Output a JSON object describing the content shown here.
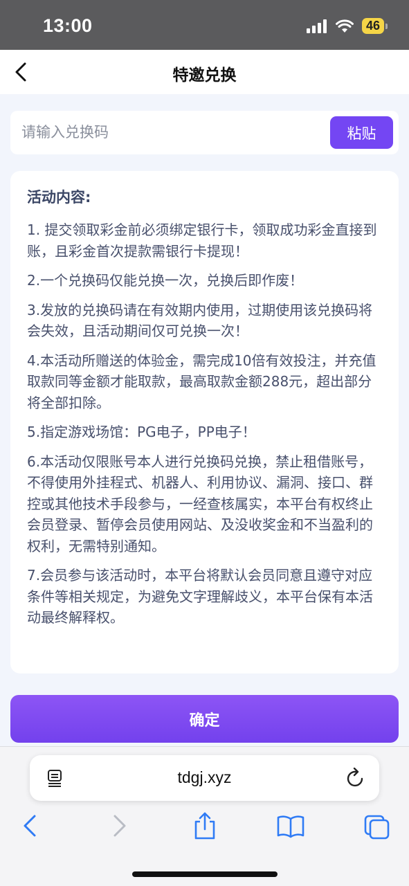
{
  "status": {
    "time": "13:00",
    "battery": "46"
  },
  "nav": {
    "title": "特邀兑换"
  },
  "redeem": {
    "placeholder": "请输入兑换码",
    "value": "",
    "paste_label": "粘贴"
  },
  "content": {
    "heading": "活动内容:",
    "rules": [
      "1. 提交领取彩金前必须绑定银行卡，领取成功彩金直接到账，且彩金首次提款需银行卡提现！",
      "2.一个兑换码仅能兑换一次，兑换后即作废！",
      "3.发放的兑换码请在有效期内使用，过期使用该兑换码将会失效，且活动期间仅可兑换一次！",
      "4.本活动所赠送的体验金，需完成10倍有效投注，并充值取款同等金额才能取款，最高取款金额288元，超出部分将全部扣除。",
      "5.指定游戏场馆：PG电子，PP电子！",
      "6.本活动仅限账号本人进行兑换码兑换，禁止租借账号，不得使用外挂程式、机器人、利用协议、漏洞、接口、群控或其他技术手段参与，一经查核属实，本平台有权终止会员登录、暂停会员使用网站、及没收奖金和不当盈利的权利，无需特别通知。",
      "7.会员参与该活动时，本平台将默认会员同意且遵守对应条件等相关规定，为避免文字理解歧义，本平台保有本活动最终解释权。"
    ]
  },
  "confirm_label": "确定",
  "browser": {
    "url": "tdgj.xyz"
  },
  "colors": {
    "accent": "#7446f3",
    "background": "#f2f5fc"
  }
}
